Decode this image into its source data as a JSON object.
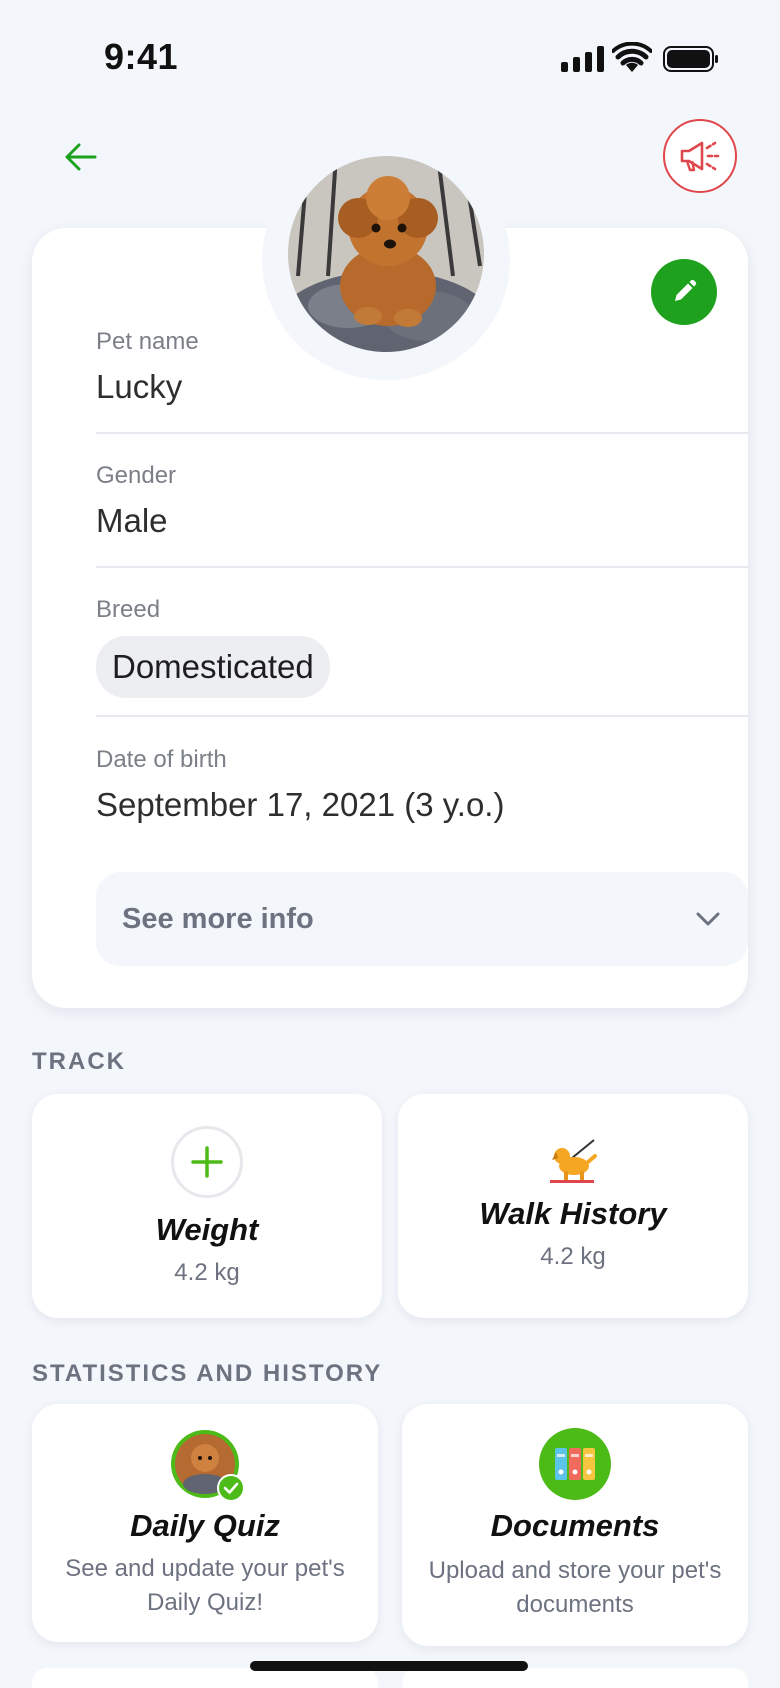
{
  "status_bar": {
    "time": "9:41"
  },
  "nav": {
    "back_icon": "arrow-left-icon",
    "action_icon": "megaphone-icon"
  },
  "profile": {
    "avatar_alt": "dog photo",
    "edit_icon": "pencil-icon",
    "pet_name_label": "Pet name",
    "pet_name": "Lucky",
    "gender_label": "Gender",
    "gender": "Male",
    "breed_label": "Breed",
    "breed": "Domesticated",
    "dob_label": "Date of birth",
    "dob": "September 17, 2021 (3 y.o.)",
    "see_more_label": "See more info"
  },
  "track": {
    "section_title": "TRACK",
    "tiles": [
      {
        "title": "Weight",
        "value": "4.2 kg",
        "icon": "plus-icon"
      },
      {
        "title": "Walk History",
        "value": "4.2 kg",
        "icon": "dog-walk-icon"
      }
    ]
  },
  "stats": {
    "section_title": "STATISTICS AND HISTORY",
    "tiles": [
      {
        "title": "Daily Quiz",
        "description": "See and update your pet's Daily Quiz!",
        "icon": "quiz-avatar-icon"
      },
      {
        "title": "Documents",
        "description": "Upload and store your pet's documents",
        "icon": "folders-icon"
      }
    ]
  },
  "colors": {
    "accent": "#1ea21e",
    "alert": "#e0474c",
    "background": "#f3f6fb"
  }
}
